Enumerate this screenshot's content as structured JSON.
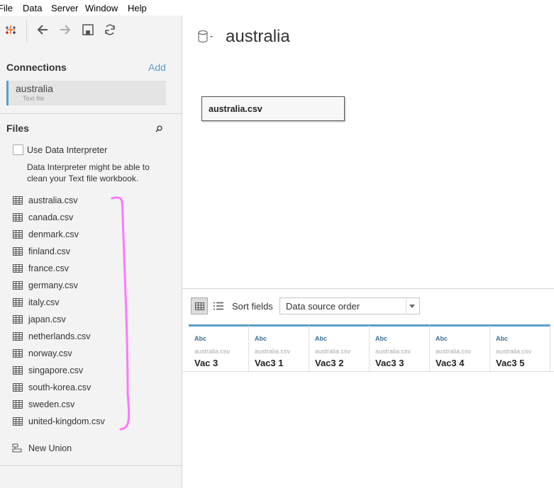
{
  "menu": [
    "File",
    "Data",
    "Server",
    "Window",
    "Help"
  ],
  "connections": {
    "title": "Connections",
    "add": "Add",
    "item": {
      "name": "australia",
      "type": "Text file"
    }
  },
  "files": {
    "title": "Files",
    "interpreter_label": "Use Data Interpreter",
    "interpreter_hint_1": "Data Interpreter might be able to",
    "interpreter_hint_2": "clean your Text file workbook.",
    "items": [
      "australia.csv",
      "canada.csv",
      "denmark.csv",
      "finland.csv",
      "france.csv",
      "germany.csv",
      "italy.csv",
      "japan.csv",
      "netherlands.csv",
      "norway.csv",
      "singapore.csv",
      "south-korea.csv",
      "sweden.csv",
      "united-kingdom.csv"
    ],
    "new_union": "New Union"
  },
  "datasource": {
    "title": "australia",
    "table": "australia.csv"
  },
  "grid": {
    "sort_label": "Sort fields",
    "sort_value": "Data source order",
    "columns": [
      {
        "type": "Abc",
        "source": "australia.csv",
        "name": "Vac 3"
      },
      {
        "type": "Abc",
        "source": "australia.csv",
        "name": "Vac3 1"
      },
      {
        "type": "Abc",
        "source": "australia.csv",
        "name": "Vac3 2"
      },
      {
        "type": "Abc",
        "source": "australia.csv",
        "name": "Vac3 3"
      },
      {
        "type": "Abc",
        "source": "australia.csv",
        "name": "Vac3 4"
      },
      {
        "type": "Abc",
        "source": "australia.csv",
        "name": "Vac3 5"
      }
    ]
  },
  "colors": {
    "accent": "#5b9ec9",
    "annotation": "#ff77ff"
  }
}
